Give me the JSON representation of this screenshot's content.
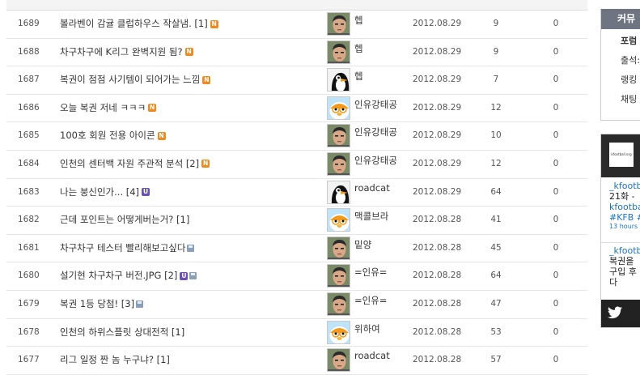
{
  "posts": [
    {
      "no": "1689",
      "title": "볼라벤이 감귤 클럽하우스 작살냄. [1]",
      "badges": [
        "N"
      ],
      "nick": "헵",
      "avatar": "soldier",
      "date": "2012.08.29",
      "views": "9",
      "rec": "0"
    },
    {
      "no": "1688",
      "title": "차구차구에 K리그 완벽지원 됨?",
      "badges": [
        "N"
      ],
      "nick": "헵",
      "avatar": "soldier",
      "date": "2012.08.29",
      "views": "9",
      "rec": "0"
    },
    {
      "no": "1687",
      "title": "복권이 점점 사기템이 되어가는 느낌",
      "badges": [
        "N"
      ],
      "nick": "헵",
      "avatar": "penguin",
      "date": "2012.08.29",
      "views": "7",
      "rec": "0"
    },
    {
      "no": "1686",
      "title": "오늘 복권 저네 ㅋㅋㅋ",
      "badges": [
        "N"
      ],
      "nick": "인유강태공",
      "avatar": "pororo",
      "date": "2012.08.29",
      "views": "12",
      "rec": "0"
    },
    {
      "no": "1685",
      "title": "100호 회원 전용 아이콘",
      "badges": [
        "N"
      ],
      "nick": "인유강태공",
      "avatar": "soldier",
      "date": "2012.08.29",
      "views": "10",
      "rec": "0"
    },
    {
      "no": "1684",
      "title": "인천의 센터백 자원 주관적 분석 [2]",
      "badges": [
        "N"
      ],
      "nick": "인유강태공",
      "avatar": "soldier",
      "date": "2012.08.29",
      "views": "12",
      "rec": "0"
    },
    {
      "no": "1683",
      "title": "나는 붕신인가... [4]",
      "badges": [
        "U"
      ],
      "nick": "roadcat",
      "avatar": "penguin",
      "date": "2012.08.29",
      "views": "64",
      "rec": "0"
    },
    {
      "no": "1682",
      "title": "근데 포인트는 어떻게버는거? [1]",
      "badges": [],
      "nick": "맥콜브라",
      "avatar": "pororo",
      "date": "2012.08.28",
      "views": "41",
      "rec": "0"
    },
    {
      "no": "1681",
      "title": "차구차구 테스터 빨리해보고싶다",
      "badges": [
        "D"
      ],
      "nick": "밑양",
      "avatar": "soldier",
      "date": "2012.08.28",
      "views": "45",
      "rec": "0"
    },
    {
      "no": "1680",
      "title": "설기현 차구차구 버전.JPG [2]",
      "badges": [
        "U",
        "D"
      ],
      "nick": "=인유=",
      "avatar": "soldier",
      "date": "2012.08.28",
      "views": "64",
      "rec": "0"
    },
    {
      "no": "1679",
      "title": "복권 1등 당첨! [3]",
      "badges": [
        "D"
      ],
      "nick": "=인유=",
      "avatar": "soldier",
      "date": "2012.08.28",
      "views": "47",
      "rec": "0"
    },
    {
      "no": "1678",
      "title": "인천의 하위스플릿 상대전적 [1]",
      "badges": [],
      "nick": "위하여",
      "avatar": "pororo",
      "date": "2012.08.28",
      "views": "53",
      "rec": "0"
    },
    {
      "no": "1677",
      "title": "리그 일정 짠 놈 누구냐? [1]",
      "badges": [],
      "nick": "roadcat",
      "avatar": "soldier",
      "date": "2012.08.28",
      "views": "57",
      "rec": "0"
    }
  ],
  "sidebar": {
    "header": "커뮤",
    "items": [
      "포럼",
      "출석:",
      "랭킹",
      "채팅"
    ]
  },
  "twitter": {
    "logo_text": "kfootball.org",
    "tweet1": {
      "link1": "_kfootb",
      "text": "21화 - ",
      "link2": "kfootba",
      "tags": "#KFB #",
      "time": "13 hours a"
    },
    "tweet2": {
      "link1": "_kfootb",
      "line1": "복권을",
      "line2": "구입 후",
      "line3": "다"
    }
  },
  "colors": {
    "new_badge": "#ef8a1e",
    "update_badge": "#6a52b5",
    "sidebar_header": "#6f7580",
    "twitter_bar": "#222222",
    "link": "#1a73c9"
  }
}
